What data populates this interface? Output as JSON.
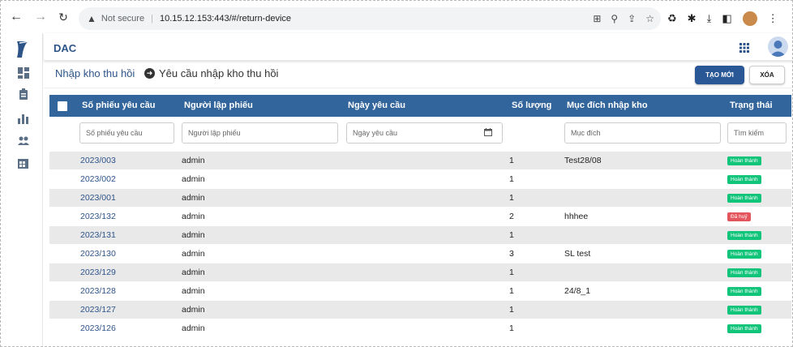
{
  "browser": {
    "security_label": "Not secure",
    "url": "10.15.12.153:443/#/return-device"
  },
  "app": {
    "brand": "DAC"
  },
  "breadcrumb": {
    "parent": "Nhập kho thu hồi",
    "current": "Yêu cầu nhập kho thu hồi"
  },
  "actions": {
    "new_label": "TẠO MỚI",
    "delete_label": "XÓA"
  },
  "table": {
    "headers": [
      "Số phiếu yêu cầu",
      "Người lập phiếu",
      "Ngày yêu cầu",
      "Số lượng",
      "Mục đích nhập kho",
      "Trạng thái"
    ],
    "filters": {
      "code": "Số phiếu yêu cầu",
      "creator": "Người lập phiếu",
      "date": "Ngày yêu cầu",
      "purpose": "Mục đích",
      "status": "Tìm kiếm"
    },
    "rows": [
      {
        "code": "2023/003",
        "creator": "admin",
        "qty": "1",
        "purpose": "Test28/08",
        "status": "Hoàn thành",
        "status_type": "ok"
      },
      {
        "code": "2023/002",
        "creator": "admin",
        "qty": "1",
        "purpose": "",
        "status": "Hoàn thành",
        "status_type": "ok"
      },
      {
        "code": "2023/001",
        "creator": "admin",
        "qty": "1",
        "purpose": "",
        "status": "Hoàn thành",
        "status_type": "ok"
      },
      {
        "code": "2023/132",
        "creator": "admin",
        "qty": "2",
        "purpose": "hhhee",
        "status": "Đã huỷ",
        "status_type": "cancel"
      },
      {
        "code": "2023/131",
        "creator": "admin",
        "qty": "1",
        "purpose": "",
        "status": "Hoàn thành",
        "status_type": "ok"
      },
      {
        "code": "2023/130",
        "creator": "admin",
        "qty": "3",
        "purpose": "SL test",
        "status": "Hoàn thành",
        "status_type": "ok"
      },
      {
        "code": "2023/129",
        "creator": "admin",
        "qty": "1",
        "purpose": "",
        "status": "Hoàn thành",
        "status_type": "ok"
      },
      {
        "code": "2023/128",
        "creator": "admin",
        "qty": "1",
        "purpose": "24/8_1",
        "status": "Hoàn thành",
        "status_type": "ok"
      },
      {
        "code": "2023/127",
        "creator": "admin",
        "qty": "1",
        "purpose": "",
        "status": "Hoàn thành",
        "status_type": "ok"
      },
      {
        "code": "2023/126",
        "creator": "admin",
        "qty": "1",
        "purpose": "",
        "status": "Hoàn thành",
        "status_type": "ok"
      }
    ]
  },
  "colors": {
    "header_bg": "#33659d",
    "accent": "#2a5897",
    "status_ok": "#10c47a",
    "status_cancel": "#e4545d"
  }
}
